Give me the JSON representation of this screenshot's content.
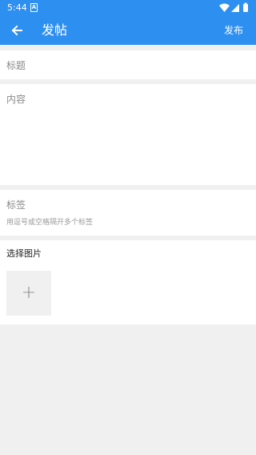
{
  "status_bar": {
    "time": "5:44",
    "notification_glyph": "A",
    "icons": [
      "wifi-icon",
      "signal-icon",
      "battery-icon"
    ]
  },
  "app_bar": {
    "back_icon": "arrow-left-icon",
    "title": "发帖",
    "publish_label": "发布"
  },
  "form": {
    "title_placeholder": "标题",
    "content_placeholder": "内容",
    "tags_placeholder": "标签",
    "tags_hint": "用逗号或空格隔开多个标签",
    "images_label": "选择图片",
    "add_image_icon": "plus-icon"
  },
  "colors": {
    "primary": "#2d8ff0",
    "background": "#f0f0f0",
    "card": "#ffffff"
  }
}
